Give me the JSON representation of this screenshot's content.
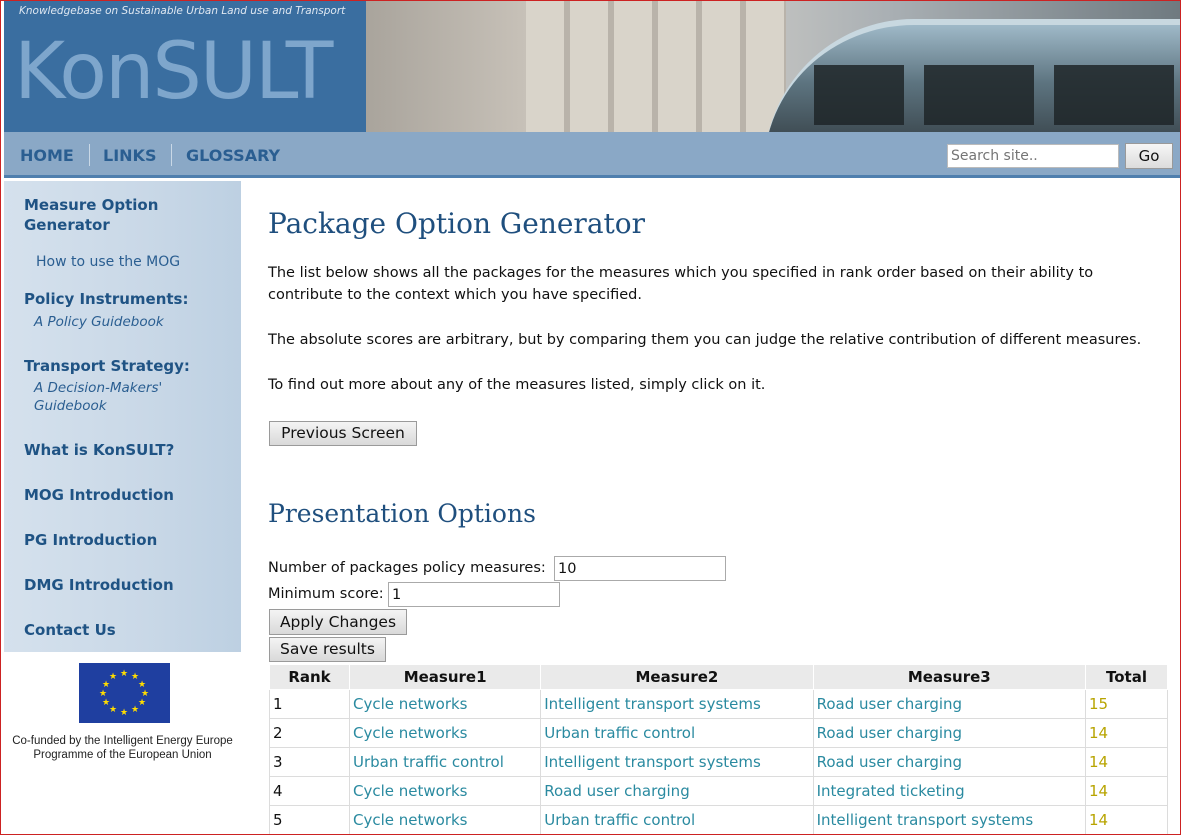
{
  "header": {
    "tagline": "Knowledgebase on Sustainable Urban Land use and Transport",
    "logo": "KonSULT"
  },
  "nav": {
    "items": [
      "HOME",
      "LINKS",
      "GLOSSARY"
    ],
    "search_placeholder": "Search site..",
    "go_label": "Go"
  },
  "sidebar": {
    "measure_option_generator": "Measure Option Generator",
    "how_to_use": "How to use the MOG",
    "policy_instruments": "Policy Instruments:",
    "policy_guidebook": "A Policy Guidebook",
    "transport_strategy": "Transport Strategy:",
    "decision_makers_guidebook": "A Decision-Makers' Guidebook",
    "what_is_konsult": "What is KonSULT?",
    "mog_intro": "MOG Introduction",
    "pg_intro": "PG Introduction",
    "dmg_intro": "DMG Introduction",
    "contact_us": "Contact Us",
    "cofunded": "Co-funded by the Intelligent Energy Europe Programme of the European Union"
  },
  "main": {
    "title": "Package Option Generator",
    "para1": "The list below shows all the packages for the measures which you specified in rank order based on their ability to contribute to the context which you have specified.",
    "para2": "The absolute scores are arbitrary, but by comparing them you can judge the relative contribution of different measures.",
    "para3": "To find out more about any of the measures listed, simply click on it.",
    "previous_screen": "Previous Screen",
    "presentation_title": "Presentation Options",
    "num_packages_label": "Number of packages policy measures:",
    "num_packages_value": "10",
    "min_score_label": "Minimum score:",
    "min_score_value": "1",
    "apply_changes": "Apply Changes",
    "save_results": "Save results"
  },
  "table": {
    "headers": [
      "Rank",
      "Measure1",
      "Measure2",
      "Measure3",
      "Total"
    ],
    "rows": [
      [
        "1",
        "Cycle networks",
        "Intelligent transport systems",
        "Road user charging",
        "15"
      ],
      [
        "2",
        "Cycle networks",
        "Urban traffic control",
        "Road user charging",
        "14"
      ],
      [
        "3",
        "Urban traffic control",
        "Intelligent transport systems",
        "Road user charging",
        "14"
      ],
      [
        "4",
        "Cycle networks",
        "Road user charging",
        "Integrated ticketing",
        "14"
      ],
      [
        "5",
        "Cycle networks",
        "Urban traffic control",
        "Intelligent transport systems",
        "14"
      ]
    ]
  },
  "colors": {
    "logo_box": "#3a6ea0",
    "nav_bar": "#8aa8c6",
    "link": "#2a8aa0",
    "total": "#b8a400",
    "heading": "#1f4f7e"
  }
}
